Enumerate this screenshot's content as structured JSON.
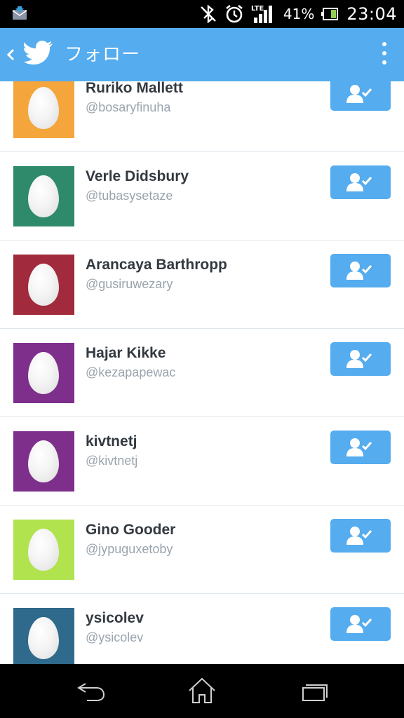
{
  "status_bar": {
    "battery_percent": "41%",
    "time": "23:04",
    "network_label": "LTE",
    "icons": [
      "mail-notification-icon",
      "bluetooth-off-icon",
      "alarm-icon",
      "signal-icon",
      "battery-icon"
    ]
  },
  "action_bar": {
    "title": "フォロー",
    "icons": [
      "back-icon",
      "twitter-bird-icon",
      "overflow-menu-icon"
    ]
  },
  "users": [
    {
      "name": "Ruriko Mallett",
      "handle": "@bosaryfinuha",
      "avatar_color": "#f4a63c"
    },
    {
      "name": "Verle Didsbury",
      "handle": "@tubasysetaze",
      "avatar_color": "#2e8a6a"
    },
    {
      "name": "Arancaya Barthropp",
      "handle": "@gusiruwezary",
      "avatar_color": "#a12a3c"
    },
    {
      "name": "Hajar Kikke",
      "handle": "@kezapapewac",
      "avatar_color": "#7e2f8c"
    },
    {
      "name": "kivtnetj",
      "handle": "@kivtnetj",
      "avatar_color": "#7e2f8c"
    },
    {
      "name": "Gino Gooder",
      "handle": "@jypuguxetoby",
      "avatar_color": "#b1e34f"
    },
    {
      "name": "ysicolev",
      "handle": "@ysicolev",
      "avatar_color": "#2f6a8c"
    }
  ],
  "follow_button": {
    "icon": "following-check-icon",
    "state": "following"
  },
  "nav_bar": {
    "icons": [
      "nav-back-icon",
      "nav-home-icon",
      "nav-recents-icon"
    ]
  },
  "colors": {
    "accent": "#55acee",
    "status_bar": "#000000",
    "divider": "#dfe6ec"
  }
}
